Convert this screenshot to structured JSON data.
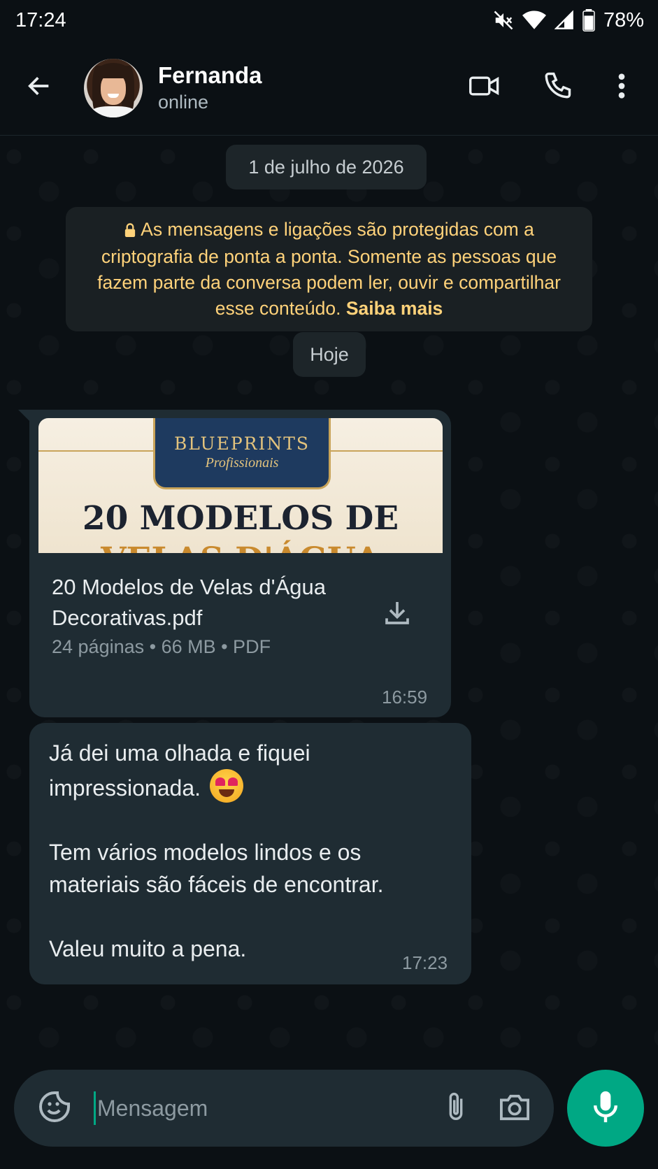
{
  "status_bar": {
    "time": "17:24",
    "battery": "78%",
    "icons": [
      "mute-icon",
      "wifi-icon",
      "signal-icon",
      "battery-icon"
    ]
  },
  "header": {
    "contact_name": "Fernanda",
    "contact_status": "online",
    "icons": [
      "back-arrow-icon",
      "video-call-icon",
      "phone-call-icon",
      "more-options-icon"
    ]
  },
  "chat": {
    "date_separator": "1 de julho de 2026",
    "encryption_notice": {
      "text": "As mensagens e ligações são protegidas com a criptografia de ponta a ponta. Somente as pessoas que fazem parte da conversa podem ler, ouvir e compartilhar esse conteúdo.",
      "link": "Saiba mais"
    },
    "today_separator": "Hoje",
    "document_message": {
      "thumbnail": {
        "brand": "BLUEPRINTS",
        "brand_sub": "Profissionais",
        "headline": "20 MODELOS DE",
        "headline2": "VELAS D'ÁGUA"
      },
      "file_name": "20 Modelos de Velas d'Água Decorativas.pdf",
      "meta": "24 páginas • 66 MB • PDF",
      "time": "16:59"
    },
    "text_message": {
      "line1": "Já dei uma olhada e fiquei\nimpressionada.",
      "emoji": "😍",
      "body": "Tem vários modelos lindos e os\nmateriais são fáceis de encontrar.\n\nValeu muito a pena.",
      "time": "17:23"
    }
  },
  "composer": {
    "placeholder": "Mensagem",
    "value": "",
    "icons": [
      "sticker-emoji-icon",
      "attach-icon",
      "camera-icon",
      "microphone-icon"
    ]
  },
  "colors": {
    "background": "#0b1014",
    "bubble": "#1f2c33",
    "accent": "#00a884",
    "notice_text": "#ffd27a"
  }
}
